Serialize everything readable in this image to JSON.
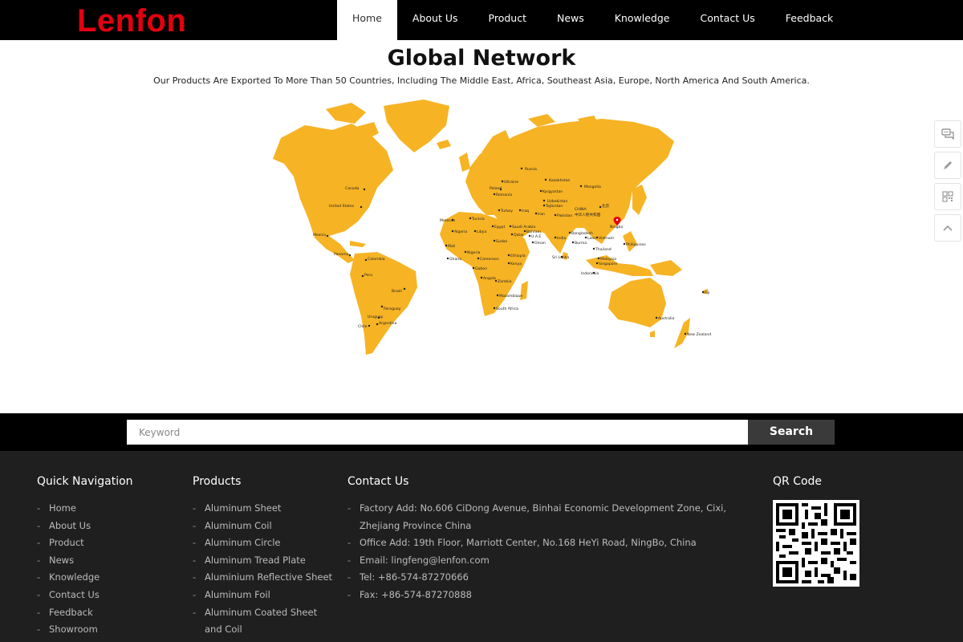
{
  "header": {
    "logo": "Lenfon",
    "nav": [
      {
        "label": "Home",
        "active": true
      },
      {
        "label": "About Us"
      },
      {
        "label": "Product"
      },
      {
        "label": "News"
      },
      {
        "label": "Knowledge"
      },
      {
        "label": "Contact Us"
      },
      {
        "label": "Feedback"
      }
    ]
  },
  "main": {
    "title": "Global Network",
    "subtitle": "Our Products Are Exported To More Than 50 Countries, Including The Middle East, Africa, Southeast Asia, Europe, North America And South America.",
    "map": {
      "land_color": "#f6b324",
      "labels": {
        "canada": "Canada",
        "united_states": "United States",
        "mexico": "Mexico",
        "panama": "Panama",
        "colombia": "Colombia",
        "peru": "Peru",
        "brazil": "Brazil",
        "paraguay": "Paraguay",
        "uruguay": "Uruguay",
        "chile": "Chile",
        "argentina": "Argentina",
        "russia": "Russia",
        "ukraine": "UKraine",
        "poland": "Poland",
        "romania": "Romania",
        "kazakhstan": "Kazakhstan",
        "kyrgyzstan": "Kyrgyzstan",
        "uzbekistan": "Uzbekistan",
        "tajikistan": "Tajikistan",
        "mongolia": "Mongolia",
        "turkey": "Turkey",
        "iraq": "Iraq",
        "iran": "Iran",
        "pakistan": "Pakistan",
        "china": "CHINA",
        "china_cn": "中华人民共和国",
        "beijing": "北京",
        "ningbo": "Ningbo",
        "morocco": "Morocco",
        "tunisia": "Tunisia",
        "algeria": "Algeria",
        "libya": "Libya",
        "egypt": "Egypt",
        "saudi_arabia": "Saudi Arabia",
        "qatar": "Qatar",
        "bahrain": "Bahrain",
        "uae": "U.A.E",
        "oman": "Oman",
        "india": "India",
        "bangladesh": "Bangladesh",
        "laos": "Laos",
        "vietnam": "Vietnam",
        "burma": "Burma",
        "thailand": "Thailand",
        "philippines": "Philippines",
        "malaysia": "Malaysia",
        "singapore": "Singapore",
        "indonesia": "Indonesia",
        "sri_lanka": "Sri Lanka",
        "mali": "Mali",
        "nigeria": "Nigeria",
        "ghana": "Ghana",
        "cameroon": "Cameroon",
        "sudan": "Sudan",
        "ethiopia": "Ethiopia",
        "kenya": "Kenya",
        "gabon": "Gabon",
        "angola": "Angola",
        "zambia": "Zambia",
        "mozambique": "Mozambique",
        "south_africa": "South Africa",
        "australia": "Australia",
        "new_zealand": "New Zealand",
        "fiji": "Fiji"
      }
    }
  },
  "float_bar": [
    "message-icon",
    "edit-icon",
    "qr-icon",
    "back-to-top-icon"
  ],
  "search": {
    "placeholder": "Keyword",
    "button_label": "Search"
  },
  "footer": {
    "nav_title": "Quick Navigation",
    "nav_items": [
      "Home",
      "About Us",
      "Product",
      "News",
      "Knowledge",
      "Contact Us",
      "Feedback",
      "Showroom"
    ],
    "products_title": "Products",
    "products": [
      "Aluminum Sheet",
      "Aluminum Coil",
      "Aluminum Circle",
      "Aluminum Tread Plate",
      "Aluminium Reflective Sheet",
      "Aluminum Foil",
      "Aluminum Coated Sheet and Coil"
    ],
    "contact_title": "Contact Us",
    "contact": [
      "Factory Add: No.606 CiDong Avenue, Binhai Economic Development Zone, Cixi, Zhejiang Province China",
      "Office Add: 19th Floor, Marriott Center, No.168 HeYi Road, NingBo, China",
      "Email: lingfeng@lenfon.com",
      "Tel: +86-574-87270666",
      "Fax: +86-574-87270888"
    ],
    "qr_title": "QR Code"
  }
}
